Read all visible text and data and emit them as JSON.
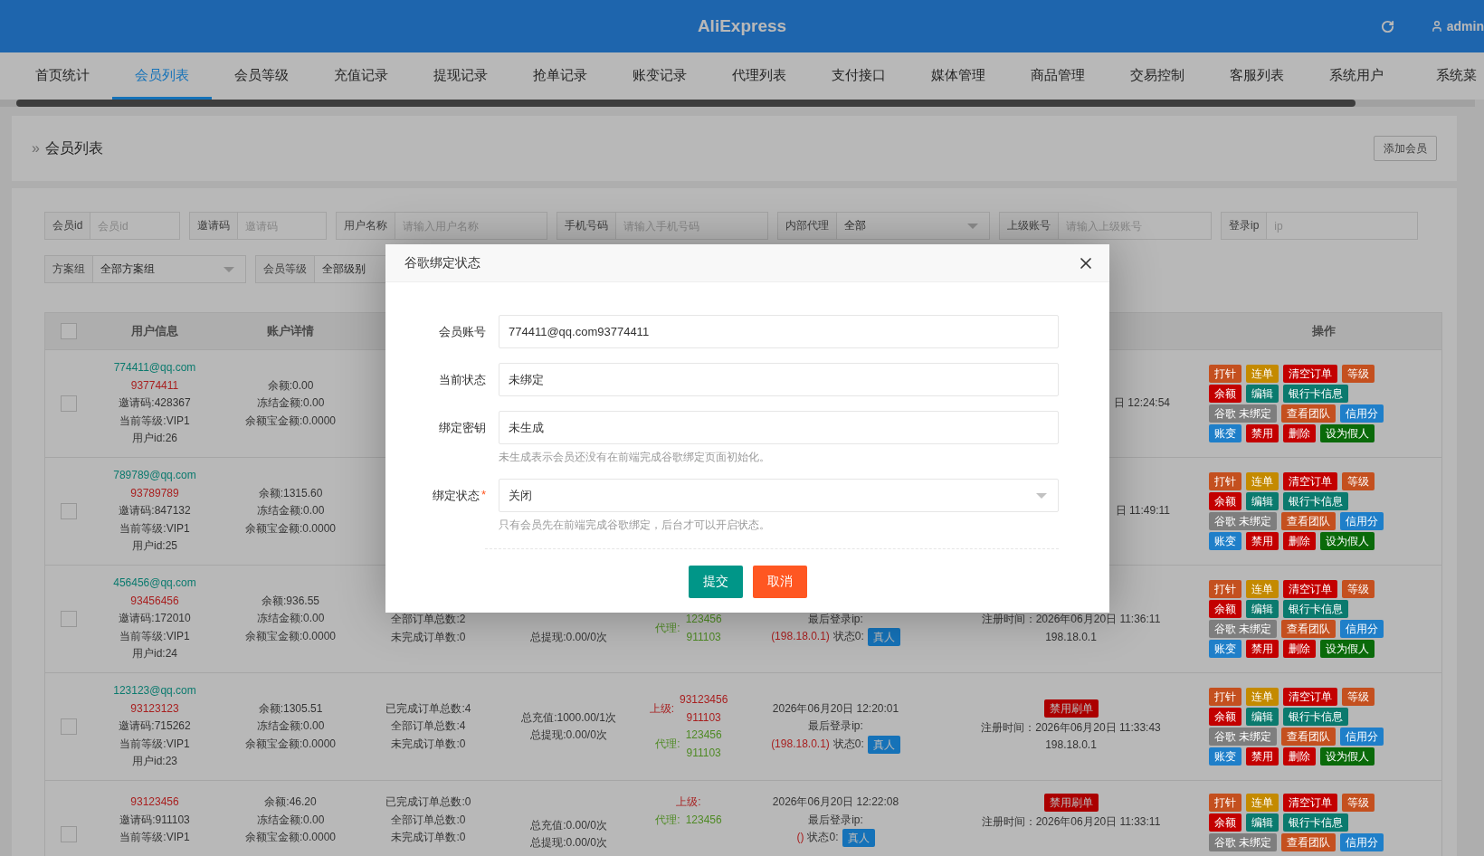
{
  "header": {
    "title": "AliExpress",
    "user": "admin"
  },
  "nav": {
    "tabs": [
      {
        "label": "首页统计",
        "selected": false
      },
      {
        "label": "会员列表",
        "selected": true
      },
      {
        "label": "会员等级",
        "selected": false
      },
      {
        "label": "充值记录",
        "selected": false
      },
      {
        "label": "提现记录",
        "selected": false
      },
      {
        "label": "抢单记录",
        "selected": false
      },
      {
        "label": "账变记录",
        "selected": false
      },
      {
        "label": "代理列表",
        "selected": false
      },
      {
        "label": "支付接口",
        "selected": false
      },
      {
        "label": "媒体管理",
        "selected": false
      },
      {
        "label": "商品管理",
        "selected": false
      },
      {
        "label": "交易控制",
        "selected": false
      },
      {
        "label": "客服列表",
        "selected": false
      },
      {
        "label": "系统用户",
        "selected": false
      },
      {
        "label": "系统菜",
        "selected": false
      }
    ]
  },
  "breadcrumb": {
    "separator": "»",
    "label": "会员列表",
    "action": "添加会员"
  },
  "filters": [
    [
      {
        "label": "会员id",
        "kind": "input",
        "placeholder": "会员id"
      },
      {
        "label": "邀请码",
        "kind": "input",
        "placeholder": "邀请码"
      },
      {
        "label": "用户名称",
        "kind": "input",
        "placeholder": "请输入用户名称"
      },
      {
        "label": "手机号码",
        "kind": "input",
        "placeholder": "请输入手机号码"
      },
      {
        "label": "内部代理",
        "kind": "select",
        "value": "全部"
      },
      {
        "label": "上级账号",
        "kind": "input",
        "placeholder": "请输入上级账号"
      },
      {
        "label": "登录ip",
        "kind": "input",
        "placeholder": "ip"
      }
    ],
    [
      {
        "label": "方案组",
        "kind": "select",
        "value": "全部方案组"
      },
      {
        "label": "会员等级",
        "kind": "select",
        "value": "全部级别"
      }
    ]
  ],
  "table": {
    "header_checked": false,
    "header": {
      "column_1": "用户信息",
      "column_2": "账户详情",
      "column_8": "操作"
    },
    "rows": [
      {
        "checked": false,
        "column_1": {
          "lines": [
            {
              "kind": "text",
              "text": "774411@qq.com",
              "color": "#0b7a6e"
            },
            {
              "kind": "text",
              "text": "93774411",
              "color": "#a82020"
            },
            {
              "kind": "text",
              "text": "邀请码:428367"
            },
            {
              "kind": "text",
              "text": "当前等级:VIP1"
            },
            {
              "kind": "text",
              "text": "用户id:26"
            }
          ]
        },
        "column_2": {
          "lines": [
            {
              "kind": "text",
              "text": "余额:0.00"
            },
            {
              "kind": "text",
              "text": "冻结金额:0.00"
            },
            {
              "kind": "text",
              "text": "余额宝金额:0.0000"
            }
          ]
        },
        "column_7": {
          "lines": [
            {
              "kind": "text",
              "text": "日 12:24:54"
            }
          ]
        },
        "column_8": {
          "actions": [
            [
              {
                "label": "打针",
                "color": "#c4501f"
              },
              {
                "label": "连单",
                "color": "#c48a00"
              },
              {
                "label": "清空订单",
                "color": "#c30000"
              },
              {
                "label": "等级",
                "color": "#c4501f"
              }
            ],
            [
              {
                "label": "余额",
                "color": "#c30000"
              },
              {
                "label": "编辑",
                "color": "#0b7a6e"
              },
              {
                "label": "银行卡信息",
                "color": "#0b7a6e"
              }
            ],
            [
              {
                "label": "谷歌 未绑定",
                "color": "#7e7e7e"
              },
              {
                "label": "查看团队",
                "color": "#c4501f"
              },
              {
                "label": "信用分",
                "color": "#1f7fc9"
              }
            ],
            [
              {
                "label": "账变",
                "color": "#1f7fc9"
              },
              {
                "label": "禁用",
                "color": "#c30000"
              },
              {
                "label": "删除",
                "color": "#c30000"
              },
              {
                "label": "设为假人",
                "color": "#0a6a0a"
              }
            ]
          ]
        }
      },
      {
        "checked": false,
        "column_1": {
          "lines": [
            {
              "kind": "text",
              "text": "789789@qq.com",
              "color": "#0b7a6e"
            },
            {
              "kind": "text",
              "text": "93789789",
              "color": "#a82020"
            },
            {
              "kind": "text",
              "text": "邀请码:847132"
            },
            {
              "kind": "text",
              "text": "当前等级:VIP1"
            },
            {
              "kind": "text",
              "text": "用户id:25"
            }
          ]
        },
        "column_2": {
          "lines": [
            {
              "kind": "text",
              "text": "余额:1315.60"
            },
            {
              "kind": "text",
              "text": "冻结金额:0.00"
            },
            {
              "kind": "text",
              "text": "余额宝金额:0.0000"
            }
          ]
        },
        "column_7": {
          "lines": [
            {
              "kind": "text",
              "text": "日 11:49:11"
            }
          ]
        },
        "column_8": {
          "actions": [
            [
              {
                "label": "打针",
                "color": "#c4501f"
              },
              {
                "label": "连单",
                "color": "#c48a00"
              },
              {
                "label": "清空订单",
                "color": "#c30000"
              },
              {
                "label": "等级",
                "color": "#c4501f"
              }
            ],
            [
              {
                "label": "余额",
                "color": "#c30000"
              },
              {
                "label": "编辑",
                "color": "#0b7a6e"
              },
              {
                "label": "银行卡信息",
                "color": "#0b7a6e"
              }
            ],
            [
              {
                "label": "谷歌 未绑定",
                "color": "#7e7e7e"
              },
              {
                "label": "查看团队",
                "color": "#c4501f"
              },
              {
                "label": "信用分",
                "color": "#1f7fc9"
              }
            ],
            [
              {
                "label": "账变",
                "color": "#1f7fc9"
              },
              {
                "label": "禁用",
                "color": "#c30000"
              },
              {
                "label": "删除",
                "color": "#c30000"
              },
              {
                "label": "设为假人",
                "color": "#0a6a0a"
              }
            ]
          ]
        }
      },
      {
        "checked": false,
        "column_1": {
          "lines": [
            {
              "kind": "text",
              "text": "456456@qq.com",
              "color": "#0b7a6e"
            },
            {
              "kind": "text",
              "text": "93456456",
              "color": "#a82020"
            },
            {
              "kind": "text",
              "text": "邀请码:172010"
            },
            {
              "kind": "text",
              "text": "当前等级:VIP1"
            },
            {
              "kind": "text",
              "text": "用户id:24"
            }
          ]
        },
        "column_2": {
          "lines": [
            {
              "kind": "text",
              "text": "余额:936.55"
            },
            {
              "kind": "text",
              "text": "冻结金额:0.00"
            },
            {
              "kind": "text",
              "text": "余额宝金额:0.0000"
            }
          ]
        },
        "column_3": {
          "lines": [
            {
              "kind": "text",
              "text": "全部订单总数:2"
            },
            {
              "kind": "text",
              "text": "未完成订单数:0"
            }
          ]
        },
        "column_4": {
          "lines": [
            {
              "kind": "text",
              "text": "总提现:0.00/0次"
            }
          ]
        },
        "column_5": {
          "groups": [
            {
              "label": "代理:",
              "color": "#4f8a25",
              "values": [
                "123456",
                "911103"
              ]
            }
          ]
        },
        "column_6": {
          "lines": [
            {
              "kind": "text",
              "text": "最后登录ip:"
            },
            {
              "kind": "status",
              "ip": "(198.18.0.1)",
              "label": "状态0:",
              "badge": "真人"
            }
          ]
        },
        "column_7": {
          "lines": [
            {
              "kind": "text",
              "text": "注册时间：2026年06月20日 11:36:11"
            },
            {
              "kind": "text",
              "text": "198.18.0.1"
            }
          ]
        },
        "column_8": {
          "actions": [
            [
              {
                "label": "打针",
                "color": "#c4501f"
              },
              {
                "label": "连单",
                "color": "#c48a00"
              },
              {
                "label": "清空订单",
                "color": "#c30000"
              },
              {
                "label": "等级",
                "color": "#c4501f"
              }
            ],
            [
              {
                "label": "余额",
                "color": "#c30000"
              },
              {
                "label": "编辑",
                "color": "#0b7a6e"
              },
              {
                "label": "银行卡信息",
                "color": "#0b7a6e"
              }
            ],
            [
              {
                "label": "谷歌 未绑定",
                "color": "#7e7e7e"
              },
              {
                "label": "查看团队",
                "color": "#c4501f"
              },
              {
                "label": "信用分",
                "color": "#1f7fc9"
              }
            ],
            [
              {
                "label": "账变",
                "color": "#1f7fc9"
              },
              {
                "label": "禁用",
                "color": "#c30000"
              },
              {
                "label": "删除",
                "color": "#c30000"
              },
              {
                "label": "设为假人",
                "color": "#0a6a0a"
              }
            ]
          ]
        }
      },
      {
        "checked": false,
        "column_1": {
          "lines": [
            {
              "kind": "text",
              "text": "123123@qq.com",
              "color": "#0b7a6e"
            },
            {
              "kind": "text",
              "text": "93123123",
              "color": "#a82020"
            },
            {
              "kind": "text",
              "text": "邀请码:715262"
            },
            {
              "kind": "text",
              "text": "当前等级:VIP1"
            },
            {
              "kind": "text",
              "text": "用户id:23"
            }
          ]
        },
        "column_2": {
          "lines": [
            {
              "kind": "text",
              "text": "余额:1305.51"
            },
            {
              "kind": "text",
              "text": "冻结金额:0.00"
            },
            {
              "kind": "text",
              "text": "余额宝金额:0.0000"
            }
          ]
        },
        "column_3": {
          "lines": [
            {
              "kind": "text",
              "text": "已完成订单总数:4"
            },
            {
              "kind": "text",
              "text": "全部订单总数:4"
            },
            {
              "kind": "text",
              "text": "未完成订单数:0"
            }
          ]
        },
        "column_4": {
          "lines": [
            {
              "kind": "text",
              "text": "总充值:1000.00/1次"
            },
            {
              "kind": "text",
              "text": "总提现:0.00/0次"
            }
          ]
        },
        "column_5": {
          "groups": [
            {
              "label": "上级:",
              "color": "#a82020",
              "values": [
                "93123456",
                "911103"
              ]
            },
            {
              "label": "代理:",
              "color": "#4f8a25",
              "values": [
                "123456",
                "911103"
              ]
            }
          ]
        },
        "column_6": {
          "lines": [
            {
              "kind": "text",
              "text": "2026年06月20日 12:20:01"
            },
            {
              "kind": "text",
              "text": "最后登录ip:"
            },
            {
              "kind": "status",
              "ip": "(198.18.0.1)",
              "label": "状态0:",
              "badge": "真人"
            }
          ]
        },
        "column_7": {
          "lines": [
            {
              "kind": "badge",
              "text": "禁用刷单"
            },
            {
              "kind": "text",
              "text": "注册时间：2026年06月20日 11:33:43"
            },
            {
              "kind": "text",
              "text": "198.18.0.1"
            }
          ]
        },
        "column_8": {
          "actions": [
            [
              {
                "label": "打针",
                "color": "#c4501f"
              },
              {
                "label": "连单",
                "color": "#c48a00"
              },
              {
                "label": "清空订单",
                "color": "#c30000"
              },
              {
                "label": "等级",
                "color": "#c4501f"
              }
            ],
            [
              {
                "label": "余额",
                "color": "#c30000"
              },
              {
                "label": "编辑",
                "color": "#0b7a6e"
              },
              {
                "label": "银行卡信息",
                "color": "#0b7a6e"
              }
            ],
            [
              {
                "label": "谷歌 未绑定",
                "color": "#7e7e7e"
              },
              {
                "label": "查看团队",
                "color": "#c4501f"
              },
              {
                "label": "信用分",
                "color": "#1f7fc9"
              }
            ],
            [
              {
                "label": "账变",
                "color": "#1f7fc9"
              },
              {
                "label": "禁用",
                "color": "#c30000"
              },
              {
                "label": "删除",
                "color": "#c30000"
              },
              {
                "label": "设为假人",
                "color": "#0a6a0a"
              }
            ]
          ]
        }
      },
      {
        "checked": false,
        "column_1": {
          "lines": [
            {
              "kind": "text",
              "text": "93123456",
              "color": "#a82020"
            },
            {
              "kind": "text",
              "text": "邀请码:911103"
            },
            {
              "kind": "text",
              "text": "当前等级:VIP1"
            }
          ]
        },
        "column_2": {
          "lines": [
            {
              "kind": "text",
              "text": "余额:46.20"
            },
            {
              "kind": "text",
              "text": "冻结金额:0.00"
            },
            {
              "kind": "text",
              "text": "余额宝金额:0.0000"
            }
          ]
        },
        "column_3": {
          "lines": [
            {
              "kind": "text",
              "text": "已完成订单总数:0"
            },
            {
              "kind": "text",
              "text": "全部订单总数:0"
            },
            {
              "kind": "text",
              "text": "未完成订单数:0"
            }
          ]
        },
        "column_4": {
          "lines": [
            {
              "kind": "text",
              "text": "总充值:0.00/0次"
            },
            {
              "kind": "text",
              "text": "总提现:0.00/0次"
            }
          ]
        },
        "column_5": {
          "groups": [
            {
              "label": "上级:",
              "color": "#a82020"
            },
            {
              "label": "代理:",
              "color": "#4f8a25",
              "values": [
                "123456"
              ]
            }
          ]
        },
        "column_6": {
          "lines": [
            {
              "kind": "text",
              "text": "2026年06月20日 12:22:08"
            },
            {
              "kind": "text",
              "text": "最后登录ip:"
            },
            {
              "kind": "status",
              "ip": "()",
              "label": "状态0:",
              "badge": "真人"
            }
          ]
        },
        "column_7": {
          "lines": [
            {
              "kind": "badge",
              "text": "禁用刷单"
            },
            {
              "kind": "text",
              "text": "注册时间：2026年06月20日 11:33:11"
            }
          ]
        },
        "column_8": {
          "actions": [
            [
              {
                "label": "打针",
                "color": "#c4501f"
              },
              {
                "label": "连单",
                "color": "#c48a00"
              },
              {
                "label": "清空订单",
                "color": "#c30000"
              },
              {
                "label": "等级",
                "color": "#c4501f"
              }
            ],
            [
              {
                "label": "余额",
                "color": "#c30000"
              },
              {
                "label": "编辑",
                "color": "#0b7a6e"
              },
              {
                "label": "银行卡信息",
                "color": "#0b7a6e"
              }
            ],
            [
              {
                "label": "谷歌 未绑定",
                "color": "#7e7e7e"
              },
              {
                "label": "查看团队",
                "color": "#c4501f"
              },
              {
                "label": "信用分",
                "color": "#1f7fc9"
              }
            ]
          ]
        }
      }
    ]
  },
  "dialog": {
    "title": "谷歌绑定状态",
    "required_mark": "*",
    "fields": [
      {
        "label": "会员账号",
        "kind": "input",
        "value": "774411@qq.com93774411",
        "required": false
      },
      {
        "label": "当前状态",
        "kind": "input",
        "value": "未绑定",
        "required": false
      },
      {
        "label": "绑定密钥",
        "kind": "input",
        "value": "未生成",
        "required": false,
        "hint": "未生成表示会员还没有在前端完成谷歌绑定页面初始化。"
      },
      {
        "label": "绑定状态",
        "kind": "select",
        "value": "关闭",
        "required": true,
        "hint": "只有会员先在前端完成谷歌绑定，后台才可以开启状态。"
      }
    ],
    "buttons": [
      {
        "label": "提交",
        "kind": "primary"
      },
      {
        "label": "取消",
        "kind": "danger"
      }
    ]
  }
}
